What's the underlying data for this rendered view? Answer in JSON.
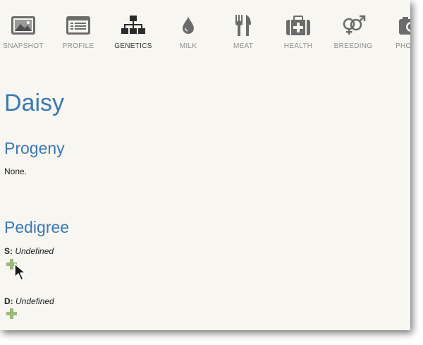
{
  "nav": {
    "items": [
      {
        "label": "SNAPSHOT",
        "icon": "image-icon"
      },
      {
        "label": "PROFILE",
        "icon": "profile-card-icon"
      },
      {
        "label": "GENETICS",
        "icon": "hierarchy-icon",
        "active": true
      },
      {
        "label": "MILK",
        "icon": "droplet-icon"
      },
      {
        "label": "MEAT",
        "icon": "fork-knife-icon"
      },
      {
        "label": "HEALTH",
        "icon": "medical-kit-icon"
      },
      {
        "label": "BREEDING",
        "icon": "gender-symbols-icon"
      },
      {
        "label": "PHOTOS",
        "icon": "camera-icon"
      }
    ]
  },
  "animal": {
    "name": "Daisy"
  },
  "progeny": {
    "title": "Progeny",
    "text": "None."
  },
  "pedigree": {
    "title": "Pedigree",
    "sire": {
      "label": "S:",
      "value": "Undefined"
    },
    "dam": {
      "label": "D:",
      "value": "Undefined"
    }
  },
  "colors": {
    "heading": "#3a78b5",
    "icon": "#6b6b6b",
    "icon_active": "#2b2b2b",
    "add_button": "#9bb97a",
    "background": "#f7f6f0"
  }
}
